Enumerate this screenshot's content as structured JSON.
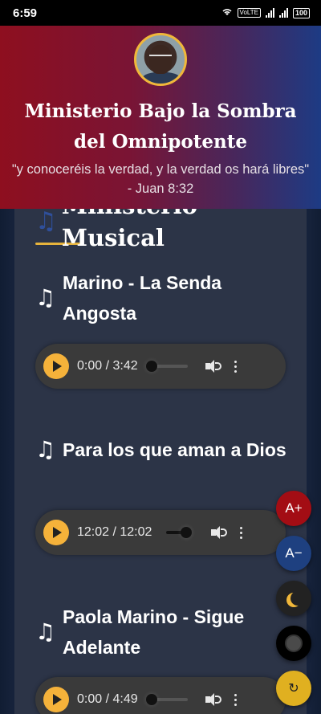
{
  "status_bar": {
    "time": "6:59",
    "volte": "VoLTE",
    "battery": "100"
  },
  "header": {
    "title": "Ministerio Bajo la Sombra del Omnipotente",
    "verse": "\"y conoceréis la verdad, y la verdad os hará libres\" - Juan 8:32"
  },
  "section": {
    "title": "Ministerio Musical",
    "icon": "music-note-icon"
  },
  "tracks": [
    {
      "name": "Marino - La Senda Angosta",
      "time": "0:00 / 3:42",
      "progress": 0.0
    },
    {
      "name": "Para los que aman a Dios",
      "time": "12:02 / 12:02",
      "progress": 1.0
    },
    {
      "name": "Paola Marino - Sigue Adelante",
      "time": "0:00 / 4:49",
      "progress": 0.0
    }
  ],
  "fabs": {
    "increase": "A+",
    "decrease": "A−",
    "reset": "↻"
  },
  "colors": {
    "accent_gold": "#e6b33c",
    "play_button": "#f5b23a",
    "header_red": "#8e0f1f",
    "header_blue": "#1d3b84"
  }
}
